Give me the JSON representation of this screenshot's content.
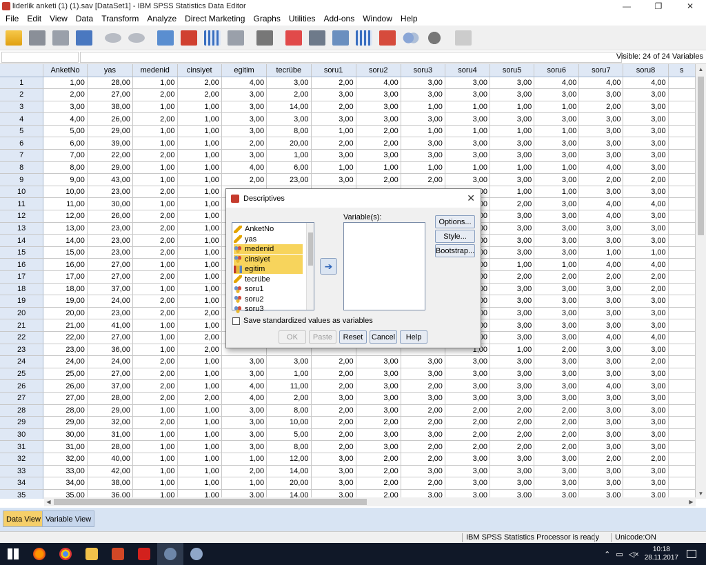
{
  "window": {
    "title": "liderlik anketi (1) (1).sav [DataSet1] - IBM SPSS Statistics Data Editor",
    "minimize": "—",
    "maximize": "❐",
    "close": "✕"
  },
  "menu": [
    "File",
    "Edit",
    "View",
    "Data",
    "Transform",
    "Analyze",
    "Direct Marketing",
    "Graphs",
    "Utilities",
    "Add-ons",
    "Window",
    "Help"
  ],
  "toolbar": [
    {
      "name": "open-icon",
      "cls": "ic-open"
    },
    {
      "name": "save-icon",
      "cls": "ic-save"
    },
    {
      "name": "print-icon",
      "cls": "ic-print"
    },
    {
      "name": "recall-dialog-icon",
      "cls": "ic-dlg"
    },
    {
      "sep": true
    },
    {
      "name": "undo-icon",
      "cls": "ic-undo"
    },
    {
      "name": "redo-icon",
      "cls": "ic-redo"
    },
    {
      "sep": true
    },
    {
      "name": "goto-case-icon",
      "cls": "ic-goto"
    },
    {
      "name": "goto-variable-icon",
      "cls": "ic-var"
    },
    {
      "name": "variables-icon",
      "cls": "ic-grid"
    },
    {
      "name": "chart-builder-icon",
      "cls": "ic-chart"
    },
    {
      "sep": true
    },
    {
      "name": "find-icon",
      "cls": "ic-find"
    },
    {
      "sep": true
    },
    {
      "name": "split-file-icon",
      "cls": "ic-split"
    },
    {
      "name": "select-cases-icon",
      "cls": "ic-sel"
    },
    {
      "name": "weight-cases-icon",
      "cls": "ic-scale"
    },
    {
      "name": "value-labels-icon",
      "cls": "ic-grid"
    },
    {
      "name": "use-variable-sets-icon",
      "cls": "ic-val"
    },
    {
      "name": "show-sets-icon",
      "cls": "ic-sets"
    },
    {
      "name": "circles-icon",
      "cls": "ic-circ"
    },
    {
      "sep": true
    },
    {
      "name": "spell-check-icon",
      "cls": "ic-abc"
    }
  ],
  "visible_label": "Visible: 24 of 24 Variables",
  "columns": [
    "AnketNo",
    "yas",
    "medenid",
    "cinsiyet",
    "egitim",
    "tecrübe",
    "soru1",
    "soru2",
    "soru3",
    "soru4",
    "soru5",
    "soru6",
    "soru7",
    "soru8",
    "s"
  ],
  "rows": [
    [
      "1,00",
      "28,00",
      "1,00",
      "2,00",
      "4,00",
      "3,00",
      "2,00",
      "4,00",
      "3,00",
      "3,00",
      "3,00",
      "4,00",
      "4,00",
      "4,00"
    ],
    [
      "2,00",
      "27,00",
      "2,00",
      "2,00",
      "3,00",
      "2,00",
      "3,00",
      "3,00",
      "3,00",
      "3,00",
      "3,00",
      "3,00",
      "3,00",
      "3,00"
    ],
    [
      "3,00",
      "38,00",
      "1,00",
      "1,00",
      "3,00",
      "14,00",
      "2,00",
      "3,00",
      "1,00",
      "1,00",
      "1,00",
      "1,00",
      "2,00",
      "3,00"
    ],
    [
      "4,00",
      "26,00",
      "2,00",
      "1,00",
      "3,00",
      "3,00",
      "3,00",
      "3,00",
      "3,00",
      "3,00",
      "3,00",
      "3,00",
      "3,00",
      "3,00"
    ],
    [
      "5,00",
      "29,00",
      "1,00",
      "1,00",
      "3,00",
      "8,00",
      "1,00",
      "2,00",
      "1,00",
      "1,00",
      "1,00",
      "1,00",
      "3,00",
      "3,00"
    ],
    [
      "6,00",
      "39,00",
      "1,00",
      "1,00",
      "2,00",
      "20,00",
      "2,00",
      "2,00",
      "3,00",
      "3,00",
      "3,00",
      "3,00",
      "3,00",
      "3,00"
    ],
    [
      "7,00",
      "22,00",
      "2,00",
      "1,00",
      "3,00",
      "1,00",
      "3,00",
      "3,00",
      "3,00",
      "3,00",
      "3,00",
      "3,00",
      "3,00",
      "3,00"
    ],
    [
      "8,00",
      "29,00",
      "1,00",
      "1,00",
      "4,00",
      "6,00",
      "1,00",
      "1,00",
      "1,00",
      "1,00",
      "1,00",
      "1,00",
      "4,00",
      "3,00"
    ],
    [
      "9,00",
      "43,00",
      "1,00",
      "1,00",
      "2,00",
      "23,00",
      "3,00",
      "2,00",
      "2,00",
      "3,00",
      "3,00",
      "3,00",
      "2,00",
      "2,00"
    ],
    [
      "10,00",
      "23,00",
      "2,00",
      "1,00",
      "",
      "",
      "",
      "",
      "",
      "1,00",
      "1,00",
      "1,00",
      "3,00",
      "3,00"
    ],
    [
      "11,00",
      "30,00",
      "1,00",
      "1,00",
      "",
      "",
      "",
      "",
      "",
      "3,00",
      "2,00",
      "3,00",
      "4,00",
      "4,00"
    ],
    [
      "12,00",
      "26,00",
      "2,00",
      "1,00",
      "",
      "",
      "",
      "",
      "",
      "3,00",
      "3,00",
      "3,00",
      "4,00",
      "3,00"
    ],
    [
      "13,00",
      "23,00",
      "2,00",
      "1,00",
      "",
      "",
      "",
      "",
      "",
      "3,00",
      "3,00",
      "3,00",
      "3,00",
      "3,00"
    ],
    [
      "14,00",
      "23,00",
      "2,00",
      "1,00",
      "",
      "",
      "",
      "",
      "",
      "3,00",
      "3,00",
      "3,00",
      "3,00",
      "3,00"
    ],
    [
      "15,00",
      "23,00",
      "2,00",
      "1,00",
      "",
      "",
      "",
      "",
      "",
      "3,00",
      "3,00",
      "3,00",
      "1,00",
      "1,00"
    ],
    [
      "16,00",
      "27,00",
      "1,00",
      "1,00",
      "",
      "",
      "",
      "",
      "",
      "1,00",
      "1,00",
      "1,00",
      "4,00",
      "4,00"
    ],
    [
      "17,00",
      "27,00",
      "2,00",
      "1,00",
      "",
      "",
      "",
      "",
      "",
      "2,00",
      "2,00",
      "2,00",
      "2,00",
      "2,00"
    ],
    [
      "18,00",
      "37,00",
      "1,00",
      "1,00",
      "",
      "",
      "",
      "",
      "",
      "3,00",
      "3,00",
      "3,00",
      "3,00",
      "2,00"
    ],
    [
      "19,00",
      "24,00",
      "2,00",
      "1,00",
      "",
      "",
      "",
      "",
      "",
      "1,00",
      "3,00",
      "3,00",
      "3,00",
      "3,00"
    ],
    [
      "20,00",
      "23,00",
      "2,00",
      "2,00",
      "",
      "",
      "",
      "",
      "",
      "3,00",
      "3,00",
      "3,00",
      "3,00",
      "3,00"
    ],
    [
      "21,00",
      "41,00",
      "1,00",
      "1,00",
      "",
      "",
      "",
      "",
      "",
      "3,00",
      "3,00",
      "3,00",
      "3,00",
      "3,00"
    ],
    [
      "22,00",
      "27,00",
      "1,00",
      "2,00",
      "",
      "",
      "",
      "",
      "",
      "4,00",
      "3,00",
      "3,00",
      "4,00",
      "4,00"
    ],
    [
      "23,00",
      "36,00",
      "1,00",
      "2,00",
      "",
      "",
      "",
      "",
      "",
      "1,00",
      "1,00",
      "2,00",
      "3,00",
      "3,00"
    ],
    [
      "24,00",
      "24,00",
      "2,00",
      "1,00",
      "3,00",
      "3,00",
      "2,00",
      "3,00",
      "3,00",
      "3,00",
      "3,00",
      "3,00",
      "3,00",
      "2,00"
    ],
    [
      "25,00",
      "27,00",
      "2,00",
      "1,00",
      "3,00",
      "1,00",
      "2,00",
      "3,00",
      "3,00",
      "3,00",
      "3,00",
      "3,00",
      "3,00",
      "3,00"
    ],
    [
      "26,00",
      "37,00",
      "2,00",
      "1,00",
      "4,00",
      "11,00",
      "2,00",
      "3,00",
      "2,00",
      "3,00",
      "3,00",
      "3,00",
      "4,00",
      "3,00"
    ],
    [
      "27,00",
      "28,00",
      "2,00",
      "2,00",
      "4,00",
      "2,00",
      "3,00",
      "3,00",
      "3,00",
      "3,00",
      "3,00",
      "3,00",
      "3,00",
      "3,00"
    ],
    [
      "28,00",
      "29,00",
      "1,00",
      "1,00",
      "3,00",
      "8,00",
      "2,00",
      "3,00",
      "2,00",
      "2,00",
      "2,00",
      "2,00",
      "3,00",
      "3,00"
    ],
    [
      "29,00",
      "32,00",
      "2,00",
      "1,00",
      "3,00",
      "10,00",
      "2,00",
      "2,00",
      "2,00",
      "2,00",
      "2,00",
      "2,00",
      "3,00",
      "3,00"
    ],
    [
      "30,00",
      "31,00",
      "1,00",
      "1,00",
      "3,00",
      "5,00",
      "2,00",
      "3,00",
      "3,00",
      "2,00",
      "2,00",
      "2,00",
      "3,00",
      "3,00"
    ],
    [
      "31,00",
      "28,00",
      "1,00",
      "1,00",
      "3,00",
      "8,00",
      "2,00",
      "3,00",
      "2,00",
      "2,00",
      "2,00",
      "2,00",
      "3,00",
      "3,00"
    ],
    [
      "32,00",
      "40,00",
      "1,00",
      "1,00",
      "1,00",
      "12,00",
      "3,00",
      "2,00",
      "2,00",
      "3,00",
      "3,00",
      "3,00",
      "2,00",
      "2,00"
    ],
    [
      "33,00",
      "42,00",
      "1,00",
      "1,00",
      "2,00",
      "14,00",
      "3,00",
      "2,00",
      "3,00",
      "3,00",
      "3,00",
      "3,00",
      "3,00",
      "3,00"
    ],
    [
      "34,00",
      "38,00",
      "1,00",
      "1,00",
      "1,00",
      "20,00",
      "3,00",
      "2,00",
      "2,00",
      "3,00",
      "3,00",
      "3,00",
      "3,00",
      "3,00"
    ],
    [
      "35,00",
      "36,00",
      "1,00",
      "1,00",
      "3,00",
      "14,00",
      "3,00",
      "2,00",
      "3,00",
      "3,00",
      "3,00",
      "3,00",
      "3,00",
      "3,00"
    ]
  ],
  "tabs": {
    "data_view": "Data View",
    "variable_view": "Variable View"
  },
  "status": {
    "processor": "IBM SPSS Statistics Processor is ready",
    "unicode": "Unicode:ON"
  },
  "taskbar": {
    "time": "10:18",
    "date": "28.11.2017"
  },
  "dialog": {
    "title": "Descriptives",
    "variables_label": "Variable(s):",
    "variable_list": [
      {
        "label": "AnketNo",
        "type": "scale",
        "selected": false
      },
      {
        "label": "yas",
        "type": "scale",
        "selected": false
      },
      {
        "label": "medenid",
        "type": "nominal",
        "selected": true
      },
      {
        "label": "cinsiyet",
        "type": "nominal",
        "selected": true
      },
      {
        "label": "egitim",
        "type": "ordinal",
        "selected": true
      },
      {
        "label": "tecrübe",
        "type": "scale",
        "selected": false
      },
      {
        "label": "soru1",
        "type": "nominal",
        "selected": false
      },
      {
        "label": "soru2",
        "type": "nominal",
        "selected": false
      },
      {
        "label": "soru3",
        "type": "nominal",
        "selected": false
      }
    ],
    "options_btn": "Options...",
    "style_btn": "Style...",
    "bootstrap_btn": "Bootstrap...",
    "checkbox_label": "Save standardized values as variables",
    "ok_btn": "OK",
    "paste_btn": "Paste",
    "reset_btn": "Reset",
    "cancel_btn": "Cancel",
    "help_btn": "Help"
  }
}
